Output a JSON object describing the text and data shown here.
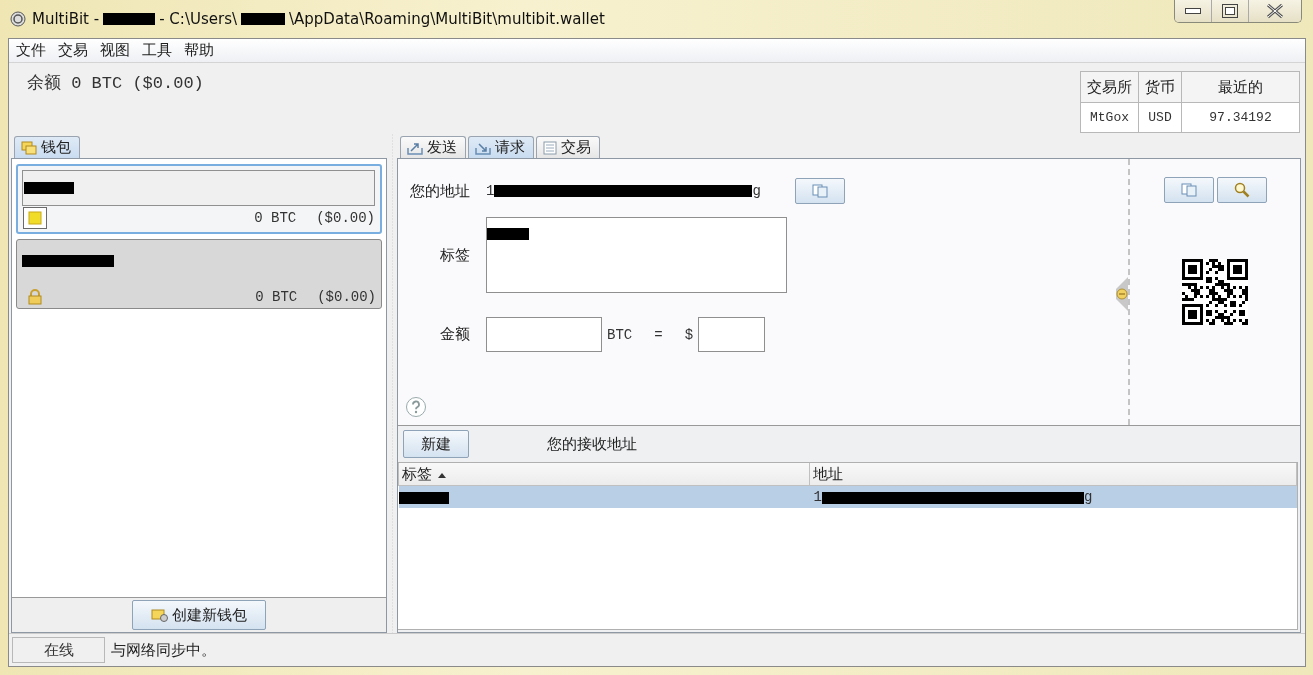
{
  "window": {
    "title_parts": [
      "MultiBit -",
      "- C:\\Users\\",
      "\\AppData\\Roaming\\MultiBit\\multibit.wallet"
    ]
  },
  "menu": [
    "文件",
    "交易",
    "视图",
    "工具",
    "帮助"
  ],
  "balance": "余额 0 BTC ($0.00)",
  "ticker": {
    "columns": [
      "交易所",
      "货币",
      "最近的"
    ],
    "row": [
      "MtGox",
      "USD",
      "97.34192"
    ]
  },
  "wallet_tab": {
    "label": "钱包"
  },
  "wallets": [
    {
      "selected": true,
      "kind": "unlocked",
      "btc": "0 BTC",
      "fiat": "($0.00)"
    },
    {
      "selected": false,
      "kind": "locked",
      "btc": "0 BTC",
      "fiat": "($0.00)"
    }
  ],
  "create_wallet_button": "创建新钱包",
  "tabs": [
    {
      "label": "发送",
      "kind": "send",
      "selected": false
    },
    {
      "label": "请求",
      "kind": "request",
      "selected": true
    },
    {
      "label": "交易",
      "kind": "transactions",
      "selected": false
    }
  ],
  "request": {
    "address_label": "您的地址",
    "address_start": "1",
    "address_end": "g",
    "label_label": "标签",
    "amount_label": "金额",
    "btc_unit": "BTC",
    "equals": "=",
    "fiat_symbol": "$"
  },
  "new_button": "新建",
  "addresses_title": "您的接收地址",
  "address_table": {
    "columns": [
      {
        "label": "标签",
        "sorted": true
      },
      {
        "label": "地址",
        "sorted": false
      }
    ],
    "rows": [
      {
        "selected": true,
        "address_start": "1",
        "address_end": "g"
      }
    ]
  },
  "status": {
    "online": "在线",
    "message": "与网络同步中。"
  }
}
